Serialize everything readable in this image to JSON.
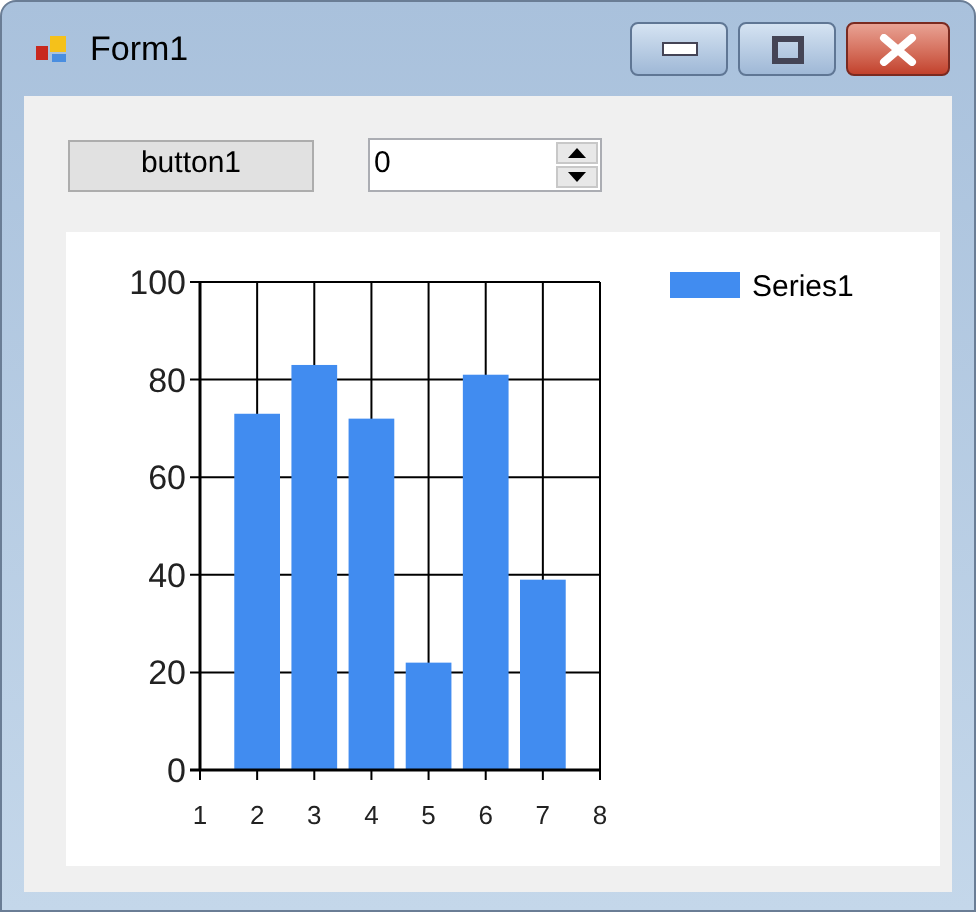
{
  "window": {
    "title": "Form1"
  },
  "button": {
    "label": "button1"
  },
  "spinner": {
    "value": "0"
  },
  "chart": {
    "chart_data": {
      "type": "bar",
      "x": [
        2,
        3,
        4,
        5,
        6,
        7
      ],
      "series": [
        {
          "name": "Series1",
          "color": "#418cf0",
          "values": [
            73,
            83,
            72,
            22,
            81,
            39
          ]
        }
      ],
      "xlim": [
        1,
        8
      ],
      "ylim": [
        0,
        100
      ],
      "xticks": [
        1,
        2,
        3,
        4,
        5,
        6,
        7,
        8
      ],
      "yticks": [
        0,
        20,
        40,
        60,
        80,
        100
      ],
      "grid": true
    }
  }
}
